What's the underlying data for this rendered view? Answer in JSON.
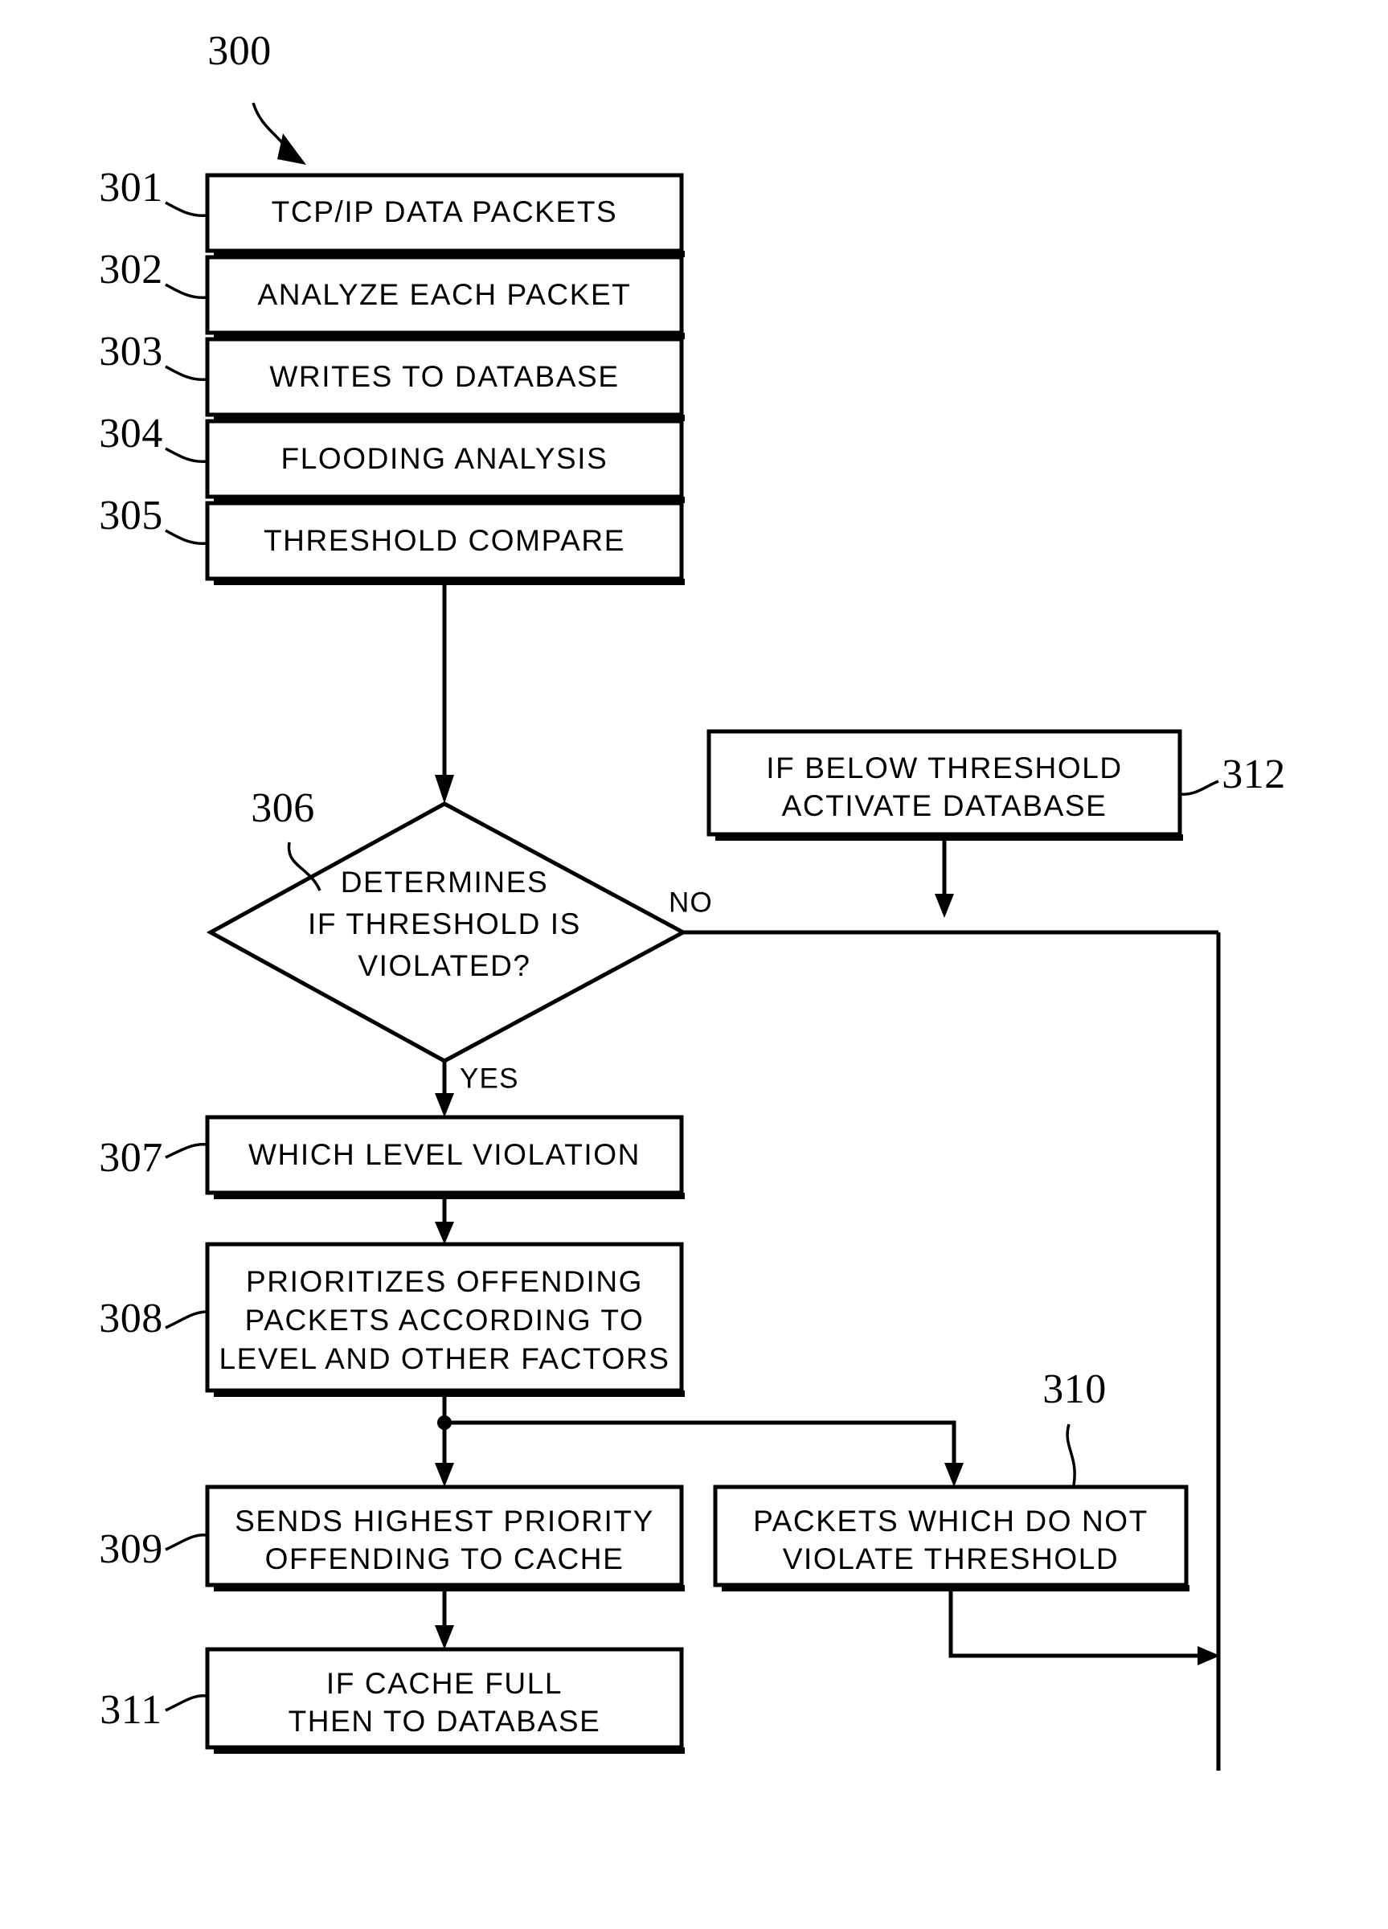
{
  "figure": {
    "figure_number": "300",
    "nodes": [
      {
        "id": "301",
        "ref": "301",
        "shape": "process",
        "lines": [
          "TCP/IP DATA PACKETS"
        ]
      },
      {
        "id": "302",
        "ref": "302",
        "shape": "process",
        "lines": [
          "ANALYZE EACH PACKET"
        ]
      },
      {
        "id": "303",
        "ref": "303",
        "shape": "process",
        "lines": [
          "WRITES TO DATABASE"
        ]
      },
      {
        "id": "304",
        "ref": "304",
        "shape": "process",
        "lines": [
          "FLOODING ANALYSIS"
        ]
      },
      {
        "id": "305",
        "ref": "305",
        "shape": "process",
        "lines": [
          "THRESHOLD COMPARE"
        ]
      },
      {
        "id": "306",
        "ref": "306",
        "shape": "decision",
        "lines": [
          "DETERMINES",
          "IF THRESHOLD IS",
          "VIOLATED?"
        ]
      },
      {
        "id": "307",
        "ref": "307",
        "shape": "process",
        "lines": [
          "WHICH LEVEL VIOLATION"
        ]
      },
      {
        "id": "308",
        "ref": "308",
        "shape": "process",
        "lines": [
          "PRIORITIZES OFFENDING",
          "PACKETS ACCORDING TO",
          "LEVEL AND OTHER FACTORS"
        ]
      },
      {
        "id": "309",
        "ref": "309",
        "shape": "process",
        "lines": [
          "SENDS HIGHEST PRIORITY",
          "OFFENDING TO CACHE"
        ]
      },
      {
        "id": "310",
        "ref": "310",
        "shape": "process",
        "lines": [
          "PACKETS WHICH DO NOT",
          "VIOLATE THRESHOLD"
        ]
      },
      {
        "id": "311",
        "ref": "311",
        "shape": "process",
        "lines": [
          "IF CACHE FULL",
          "THEN TO DATABASE"
        ]
      },
      {
        "id": "312",
        "ref": "312",
        "shape": "process",
        "lines": [
          "IF BELOW THRESHOLD",
          "ACTIVATE DATABASE"
        ]
      }
    ],
    "edge_labels": {
      "no": "NO",
      "yes": "YES"
    },
    "colors": {
      "ink": "#000000",
      "paper": "#ffffff"
    }
  }
}
